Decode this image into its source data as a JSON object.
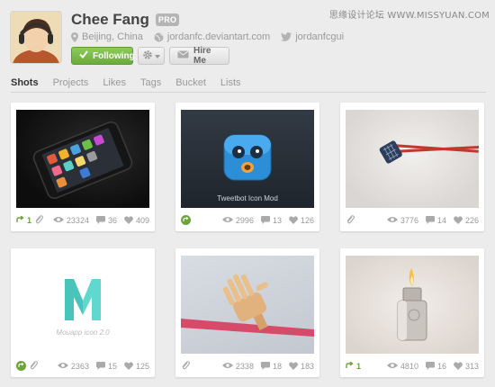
{
  "watermark": "思缘设计论坛  WWW.MISSYUAN.COM",
  "profile": {
    "name": "Chee Fang",
    "badge": "PRO",
    "location": "Beijing, China",
    "website": "jordanfc.deviantart.com",
    "twitter": "jordanfcgui",
    "follow_label": "Following",
    "hire_label": "Hire Me"
  },
  "tabs": [
    "Shots",
    "Projects",
    "Likes",
    "Tags",
    "Bucket",
    "Lists"
  ],
  "active_tab": "Shots",
  "colors": {
    "accent_green": "#6cab3b",
    "badge_gray": "#b5b5b5",
    "page_bg": "#ececec"
  },
  "shots": [
    {
      "rebounds": "1",
      "has_rebound_badge": false,
      "has_attachment": true,
      "views": "23324",
      "comments": "36",
      "likes": "409"
    },
    {
      "rebounds": "",
      "has_rebound_badge": true,
      "has_attachment": false,
      "views": "2996",
      "comments": "13",
      "likes": "126",
      "caption": "Tweetbot Icon Mod"
    },
    {
      "rebounds": "",
      "has_rebound_badge": false,
      "has_attachment": true,
      "views": "3776",
      "comments": "14",
      "likes": "226"
    },
    {
      "rebounds": "",
      "has_rebound_badge": true,
      "has_attachment": true,
      "views": "2363",
      "comments": "15",
      "likes": "125",
      "caption": "Mouapp icon 2.0"
    },
    {
      "rebounds": "",
      "has_rebound_badge": false,
      "has_attachment": true,
      "views": "2338",
      "comments": "18",
      "likes": "183"
    },
    {
      "rebounds": "1",
      "has_rebound_badge": false,
      "has_attachment": false,
      "views": "4810",
      "comments": "16",
      "likes": "313"
    }
  ]
}
